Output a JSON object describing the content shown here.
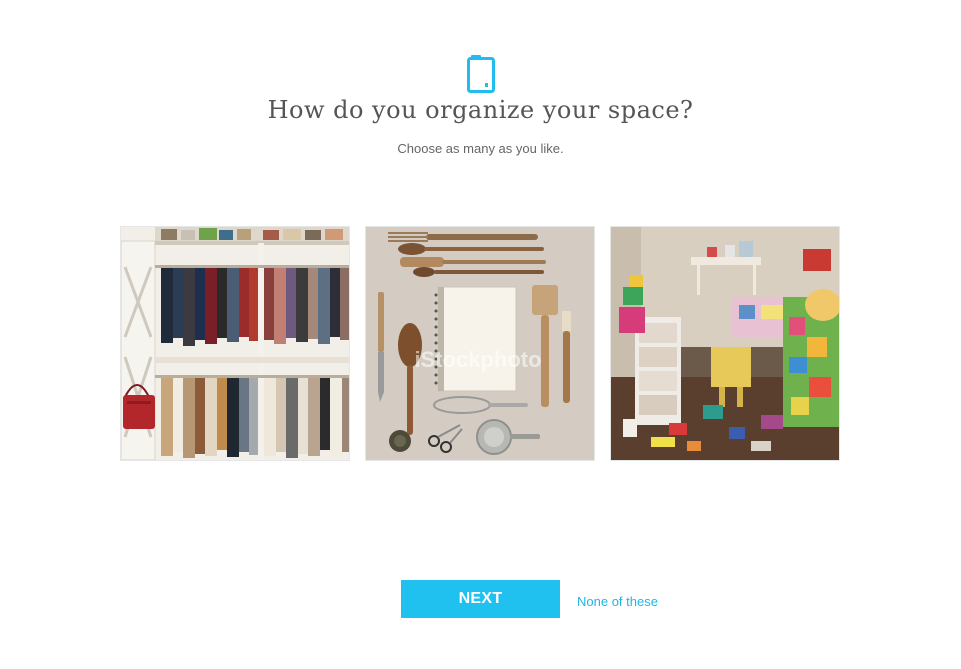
{
  "header": {
    "icon": "clipboard-icon",
    "title": "How do you organize your space?",
    "subtitle": "Choose as many as you like."
  },
  "options": [
    {
      "icon": "closet-photo",
      "alt": "closet"
    },
    {
      "icon": "flatlay-photo",
      "alt": "tools",
      "watermark": "iStockphoto"
    },
    {
      "icon": "messy-room-photo",
      "alt": "messy room"
    }
  ],
  "actions": {
    "next_label": "NEXT",
    "none_label": "None of these"
  },
  "colors": {
    "accent": "#20c0ef",
    "link": "#20b6e6",
    "title": "#555555",
    "subtitle": "#666666"
  }
}
